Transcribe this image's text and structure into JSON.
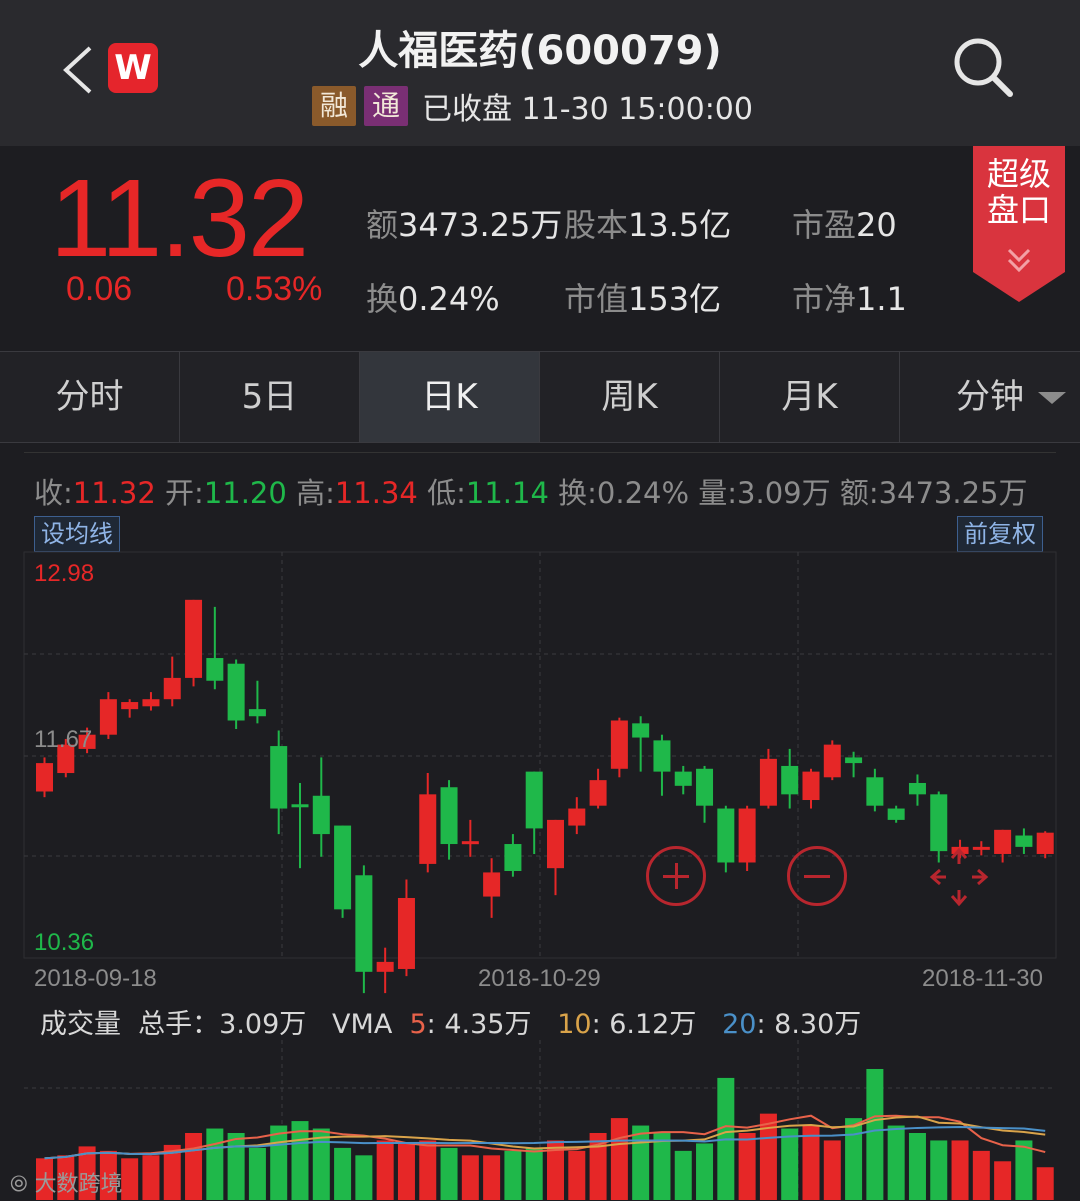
{
  "header": {
    "title": "人福医药(600079)",
    "tag1": "融",
    "tag2": "通",
    "status": "已收盘 11-30 15:00:00",
    "logo": "W"
  },
  "quote": {
    "price": "11.32",
    "change": "0.06",
    "change_pct": "0.53%",
    "stats": [
      {
        "label": "额",
        "value": "3473.25万"
      },
      {
        "label": "股本",
        "value": "13.5亿"
      },
      {
        "label": "市盈",
        "value": "20"
      },
      {
        "label": "换",
        "value": "0.24%"
      },
      {
        "label": "市值",
        "value": "153亿"
      },
      {
        "label": "市净",
        "value": "1.1"
      }
    ],
    "super_button": [
      "超级",
      "盘口"
    ]
  },
  "tabs": [
    "分时",
    "5日",
    "日K",
    "周K",
    "月K",
    "分钟"
  ],
  "active_tab": "日K",
  "ohlc": {
    "close_label": "收:",
    "close": "11.32",
    "open_label": "开:",
    "open": "11.20",
    "high_label": "高:",
    "high": "11.34",
    "low_label": "低:",
    "low": "11.14",
    "turnover": "换:0.24%",
    "volume": "量:3.09万",
    "amount": "额:3473.25万"
  },
  "buttons": {
    "ma": "设均线",
    "adjust": "前复权"
  },
  "price_axis": {
    "top": "12.98",
    "mid": "11.67",
    "bottom": "10.36"
  },
  "dates": [
    "2018-09-18",
    "2018-10-29",
    "2018-11-30"
  ],
  "volume_bar": {
    "label": "成交量",
    "total": "总手：3.09万",
    "vma": "VMA",
    "ma5_key": "5",
    "ma5": ": 4.35万",
    "ma10_key": "10",
    "ma10": ": 6.12万",
    "ma20_key": "20",
    "ma20": ": 8.30万"
  },
  "watermark": "大数跨境",
  "colors": {
    "up": "#e62727",
    "down": "#1fb84a",
    "ma5": "#e8624a",
    "ma10": "#d9a34a",
    "ma20": "#4a90c8"
  },
  "chart_data": {
    "type": "candlestick",
    "y_range": [
      10.36,
      12.98
    ],
    "candles": [
      {
        "o": 11.42,
        "c": 11.62,
        "h": 11.66,
        "l": 11.38
      },
      {
        "o": 11.55,
        "c": 11.75,
        "h": 11.79,
        "l": 11.52
      },
      {
        "o": 11.72,
        "c": 11.82,
        "h": 11.87,
        "l": 11.69
      },
      {
        "o": 11.82,
        "c": 12.07,
        "h": 12.12,
        "l": 11.79
      },
      {
        "o": 12.0,
        "c": 12.05,
        "h": 12.07,
        "l": 11.94
      },
      {
        "o": 12.02,
        "c": 12.07,
        "h": 12.12,
        "l": 11.99
      },
      {
        "o": 12.07,
        "c": 12.22,
        "h": 12.37,
        "l": 12.02
      },
      {
        "o": 12.22,
        "c": 12.77,
        "h": 12.77,
        "l": 12.16
      },
      {
        "o": 12.36,
        "c": 12.2,
        "h": 12.72,
        "l": 12.14
      },
      {
        "o": 12.32,
        "c": 11.92,
        "h": 12.35,
        "l": 11.86
      },
      {
        "o": 12.0,
        "c": 11.95,
        "h": 12.2,
        "l": 11.9
      },
      {
        "o": 11.74,
        "c": 11.3,
        "h": 11.85,
        "l": 11.12
      },
      {
        "o": 11.33,
        "c": 11.32,
        "h": 11.48,
        "l": 10.88
      },
      {
        "o": 11.39,
        "c": 11.12,
        "h": 11.66,
        "l": 10.96
      },
      {
        "o": 11.18,
        "c": 10.59,
        "h": 11.18,
        "l": 10.53
      },
      {
        "o": 10.83,
        "c": 10.15,
        "h": 10.9,
        "l": 10.0
      },
      {
        "o": 10.15,
        "c": 10.22,
        "h": 10.32,
        "l": 10.0
      },
      {
        "o": 10.17,
        "c": 10.67,
        "h": 10.8,
        "l": 10.12
      },
      {
        "o": 10.91,
        "c": 11.4,
        "h": 11.55,
        "l": 10.85
      },
      {
        "o": 11.45,
        "c": 11.05,
        "h": 11.5,
        "l": 10.94
      },
      {
        "o": 11.07,
        "c": 11.07,
        "h": 11.22,
        "l": 10.96
      },
      {
        "o": 10.68,
        "c": 10.85,
        "h": 10.95,
        "l": 10.53
      },
      {
        "o": 11.05,
        "c": 10.86,
        "h": 11.12,
        "l": 10.82
      },
      {
        "o": 11.56,
        "c": 11.16,
        "h": 11.56,
        "l": 10.98
      },
      {
        "o": 10.88,
        "c": 11.22,
        "h": 11.22,
        "l": 10.69
      },
      {
        "o": 11.18,
        "c": 11.3,
        "h": 11.38,
        "l": 11.12
      },
      {
        "o": 11.32,
        "c": 11.5,
        "h": 11.58,
        "l": 11.3
      },
      {
        "o": 11.58,
        "c": 11.92,
        "h": 11.94,
        "l": 11.52
      },
      {
        "o": 11.9,
        "c": 11.8,
        "h": 11.95,
        "l": 11.56
      },
      {
        "o": 11.78,
        "c": 11.56,
        "h": 11.82,
        "l": 11.39
      },
      {
        "o": 11.56,
        "c": 11.46,
        "h": 11.6,
        "l": 11.4
      },
      {
        "o": 11.58,
        "c": 11.32,
        "h": 11.6,
        "l": 11.2
      },
      {
        "o": 11.3,
        "c": 10.92,
        "h": 11.32,
        "l": 10.85
      },
      {
        "o": 10.92,
        "c": 11.3,
        "h": 11.32,
        "l": 10.86
      },
      {
        "o": 11.32,
        "c": 11.65,
        "h": 11.72,
        "l": 11.3
      },
      {
        "o": 11.6,
        "c": 11.4,
        "h": 11.72,
        "l": 11.3
      },
      {
        "o": 11.36,
        "c": 11.56,
        "h": 11.58,
        "l": 11.3
      },
      {
        "o": 11.52,
        "c": 11.75,
        "h": 11.78,
        "l": 11.5
      },
      {
        "o": 11.66,
        "c": 11.62,
        "h": 11.7,
        "l": 11.52
      },
      {
        "o": 11.52,
        "c": 11.32,
        "h": 11.58,
        "l": 11.28
      },
      {
        "o": 11.3,
        "c": 11.22,
        "h": 11.32,
        "l": 11.2
      },
      {
        "o": 11.48,
        "c": 11.4,
        "h": 11.54,
        "l": 11.32
      },
      {
        "o": 11.4,
        "c": 11.0,
        "h": 11.42,
        "l": 10.92
      },
      {
        "o": 10.98,
        "c": 11.03,
        "h": 11.08,
        "l": 10.95
      },
      {
        "o": 11.02,
        "c": 11.03,
        "h": 11.07,
        "l": 10.97
      },
      {
        "o": 10.98,
        "c": 11.15,
        "h": 11.15,
        "l": 10.92
      },
      {
        "o": 11.11,
        "c": 11.03,
        "h": 11.16,
        "l": 10.98
      },
      {
        "o": 10.98,
        "c": 11.13,
        "h": 11.14,
        "l": 10.95
      }
    ],
    "volume": [
      28,
      30,
      36,
      33,
      28,
      30,
      37,
      45,
      48,
      45,
      35,
      50,
      53,
      48,
      35,
      30,
      40,
      38,
      40,
      35,
      30,
      30,
      33,
      35,
      40,
      33,
      45,
      55,
      50,
      45,
      33,
      38,
      82,
      45,
      58,
      48,
      50,
      40,
      55,
      88,
      50,
      45,
      40,
      40,
      33,
      26,
      40,
      22
    ],
    "dates": [
      "2018-09-18",
      "2018-10-29",
      "2018-11-30"
    ]
  }
}
